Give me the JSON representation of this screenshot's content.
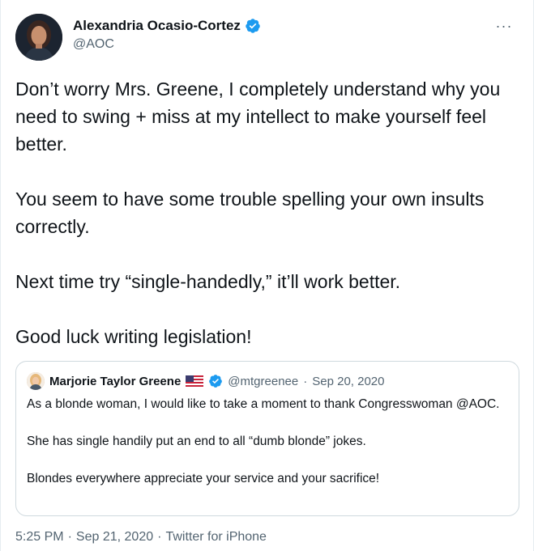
{
  "author": {
    "name": "Alexandria Ocasio-Cortez",
    "handle": "@AOC",
    "verified": true
  },
  "more_icon": "more-horizontal-icon",
  "more_label": "···",
  "tweet": {
    "paragraphs": [
      "Don’t worry Mrs. Greene, I completely understand why you need to swing + miss at my intellect to make yourself feel better.",
      "You seem to have some trouble spelling your own insults correctly.",
      "Next time try “single-handedly,” it’ll work better.",
      "Good luck writing legislation!"
    ]
  },
  "quoted": {
    "name": "Marjorie Taylor Greene",
    "flag_icon": "us-flag-icon",
    "verified": true,
    "handle": "@mtgreenee",
    "separator": "·",
    "date": "Sep 20, 2020",
    "paragraphs": [
      "As a blonde woman, I would like to take a moment to thank Congresswoman @AOC.",
      "She has single handily put an end to all “dumb blonde” jokes.",
      "Blondes everywhere appreciate your service and your sacrifice!"
    ]
  },
  "meta": {
    "time": "5:25 PM",
    "separator": "·",
    "date": "Sep 21, 2020",
    "source": "Twitter for iPhone"
  },
  "colors": {
    "verified_blue": "#1d9bf0",
    "secondary_text": "#536471",
    "border": "#cfd9de"
  }
}
